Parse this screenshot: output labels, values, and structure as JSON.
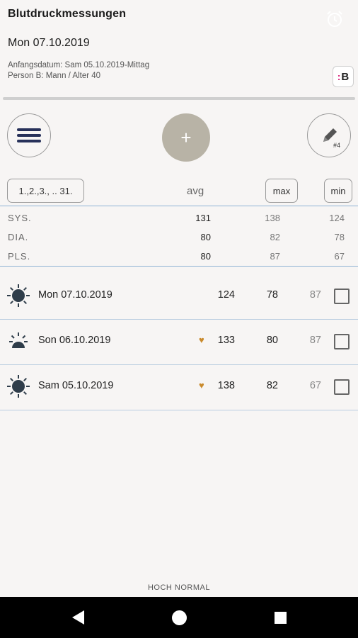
{
  "header": {
    "title": "Blutdruckmessungen",
    "date": "Mon 07.10.2019",
    "start_info": "Anfangsdatum: Sam 05.10.2019-Mittag",
    "person_info": "Person B: Mann / Alter 40",
    "badge_label": "B"
  },
  "controls": {
    "add_label": "+",
    "edit_number": "#4",
    "days_label": "1.,2.,3., .. 31.",
    "avg_label": "avg",
    "max_label": "max",
    "min_label": "min"
  },
  "stats": [
    {
      "label": "SYS.",
      "avg": "131",
      "max": "138",
      "min": "124"
    },
    {
      "label": "DIA.",
      "avg": "80",
      "max": "82",
      "min": "78"
    },
    {
      "label": "PLS.",
      "avg": "80",
      "max": "87",
      "min": "67"
    }
  ],
  "entries": [
    {
      "icon": "sun-icon",
      "date": "Mon 07.10.2019",
      "heart": "",
      "sys": "124",
      "dia": "78",
      "pls": "87"
    },
    {
      "icon": "sunset-icon",
      "date": "Son 06.10.2019",
      "heart": "♥",
      "sys": "133",
      "dia": "80",
      "pls": "87"
    },
    {
      "icon": "sun-icon",
      "date": "Sam 05.10.2019",
      "heart": "♥",
      "sys": "138",
      "dia": "82",
      "pls": "67"
    }
  ],
  "footer": {
    "label": "HOCH NORMAL"
  },
  "colors": {
    "background": "#f7f5f4",
    "add_button": "#b8b3a6",
    "menu_bars": "#27315a",
    "heart": "#c98a2c",
    "badge_accent": "#d81f78",
    "divider": "#8fb2d4"
  }
}
